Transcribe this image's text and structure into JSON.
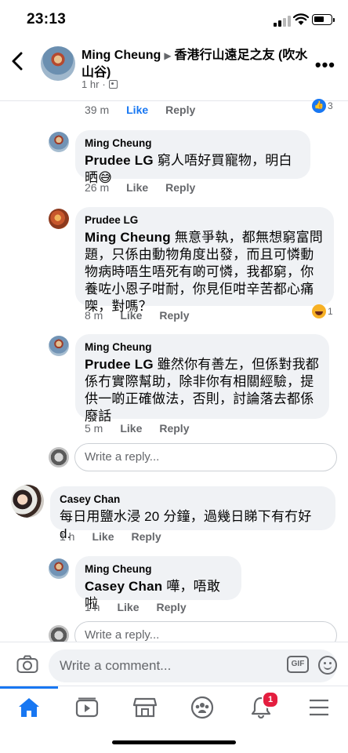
{
  "status_bar": {
    "time": "23:13"
  },
  "header": {
    "author": "Ming Cheung",
    "group": "香港行山遠足之友 (吹水山谷)",
    "age": "1 hr"
  },
  "top_comment_actions": {
    "time": "39 m",
    "like": "Like",
    "reply": "Reply",
    "reaction_count": "3"
  },
  "comments": [
    {
      "author": "Ming Cheung",
      "tag": "Prudee LG",
      "text": " 窮人唔好買寵物，明白晒😅",
      "time": "26 m",
      "like": "Like",
      "reply": "Reply"
    },
    {
      "author": "Prudee LG",
      "tag": "Ming Cheung",
      "text": " 無意爭執，都無想窮富問題，只係由動物角度出發，而且可憐動物病時唔生唔死有啲可憐，我都窮，你養咗小恩子咁耐，你見佢咁辛苦都心痛㗎，對嗎？",
      "time": "8 m",
      "like": "Like",
      "reply": "Reply",
      "reaction_count": "1"
    },
    {
      "author": "Ming Cheung",
      "tag": "Prudee LG",
      "text": " 雖然你有善左，但係對我都係冇實際幫助，除非你有相關經驗，提供一啲正確做法，否則，討論落去都係廢話",
      "time": "5 m",
      "like": "Like",
      "reply": "Reply"
    },
    {
      "author": "Casey Chan",
      "tag": "",
      "text": "每日用鹽水浸 20 分鐘，過幾日睇下有冇好 d.",
      "time": "1 h",
      "like": "Like",
      "reply": "Reply"
    },
    {
      "author": "Ming Cheung",
      "tag": "Casey Chan",
      "text": " 嘩，唔敢啦",
      "time": "1 h",
      "like": "Like",
      "reply": "Reply"
    }
  ],
  "reply_placeholder": "Write a reply...",
  "composer": {
    "placeholder": "Write a comment...",
    "gif_label": "GIF"
  },
  "tab_bar": {
    "notification_badge": "1"
  },
  "colors": {
    "accent": "#1877f2",
    "bubble": "#f0f2f5",
    "muted": "#65676b",
    "badge": "#e41e3f"
  }
}
